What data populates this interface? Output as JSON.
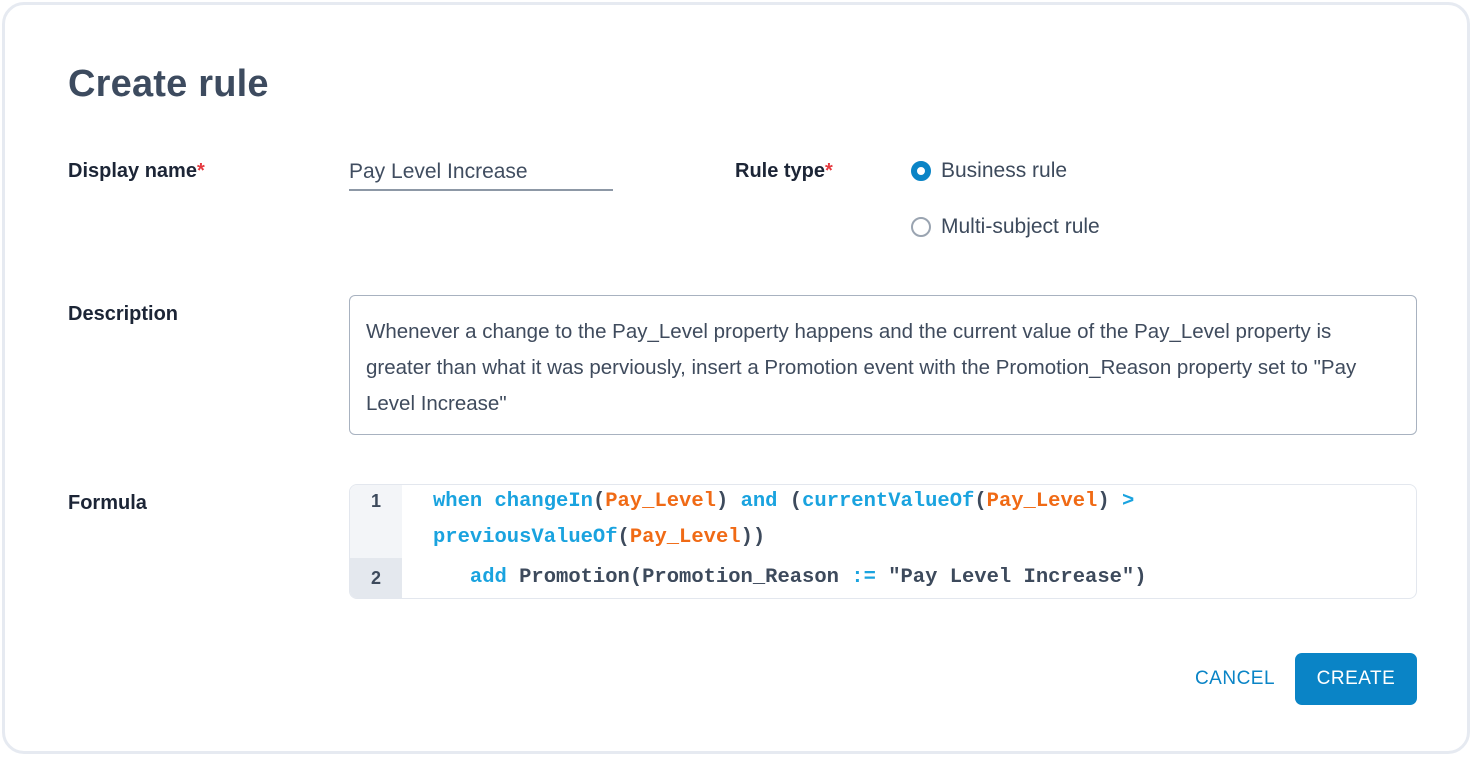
{
  "dialog": {
    "title": "Create rule"
  },
  "display_name": {
    "label": "Display name",
    "required_marker": "*",
    "value": "Pay Level Increase"
  },
  "rule_type": {
    "label": "Rule type",
    "required_marker": "*",
    "options": [
      {
        "label": "Business rule",
        "selected": true
      },
      {
        "label": "Multi-subject rule",
        "selected": false
      }
    ]
  },
  "description": {
    "label": "Description",
    "value": "Whenever a change to the Pay_Level property happens and the current value of the Pay_Level property is greater than what it was perviously, insert a Promotion event with the Promotion_Reason property set to \"Pay Level Increase\""
  },
  "formula": {
    "label": "Formula",
    "line_numbers": [
      "1",
      "2"
    ],
    "lines": [
      {
        "tokens": [
          {
            "t": "when changeIn",
            "c": "kw"
          },
          {
            "t": "(",
            "c": "plain"
          },
          {
            "t": "Pay_Level",
            "c": "arg"
          },
          {
            "t": ") ",
            "c": "plain"
          },
          {
            "t": "and",
            "c": "kw"
          },
          {
            "t": " (",
            "c": "plain"
          },
          {
            "t": "currentValueOf",
            "c": "kw"
          },
          {
            "t": "(",
            "c": "plain"
          },
          {
            "t": "Pay_Level",
            "c": "arg"
          },
          {
            "t": ") ",
            "c": "plain"
          },
          {
            "t": ">",
            "c": "kw"
          }
        ]
      },
      {
        "tokens": [
          {
            "t": "previousValueOf",
            "c": "kw"
          },
          {
            "t": "(",
            "c": "plain"
          },
          {
            "t": "Pay_Level",
            "c": "arg"
          },
          {
            "t": "))",
            "c": "plain"
          }
        ]
      },
      {
        "tokens": [
          {
            "t": "   ",
            "c": "plain"
          },
          {
            "t": "add",
            "c": "kw"
          },
          {
            "t": " Promotion(Promotion_Reason ",
            "c": "plain"
          },
          {
            "t": ":=",
            "c": "kw"
          },
          {
            "t": " \"Pay Level Increase\")",
            "c": "plain"
          }
        ]
      }
    ]
  },
  "actions": {
    "cancel_label": "CANCEL",
    "create_label": "CREATE"
  },
  "colors": {
    "accent": "#0a84c6",
    "required": "#e5393f",
    "code_keyword": "#1aa3df",
    "code_argument": "#f06a15"
  }
}
